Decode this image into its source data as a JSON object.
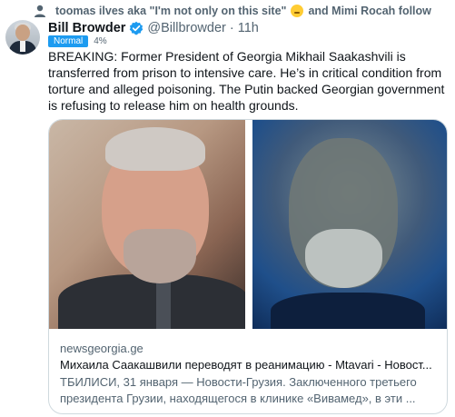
{
  "social_context": {
    "part1": "toomas ilves aka \"I'm not only on this site\"",
    "part2": "and Mimi Rocah follow"
  },
  "tweet": {
    "author_name": "Bill Browder",
    "handle": "@Billbrowder",
    "separator": "·",
    "time": "11h",
    "badge": "Normal",
    "percent": "4%",
    "text": "BREAKING: Former President of Georgia Mikhail Saakashvili is transferred from prison to intensive care. He’s in critical condition from torture and alleged poisoning. The Putin backed Georgian government is refusing to release him on health grounds."
  },
  "card": {
    "domain": "newsgeorgia.ge",
    "title": "Михаила Саакашвили переводят в реанимацию - Mtavari - Новост...",
    "description": "ТБИЛИСИ, 31 января — Новости-Грузия. Заключенного третьего президента Грузии, находящегося в клинике «Вивамед», в эти ..."
  },
  "colors": {
    "verified": "#1d9bf0",
    "badge": "#1d9bf0",
    "secondary_text": "#536471",
    "border": "#cfd9de"
  },
  "icons": {
    "social": "person-icon",
    "verified": "verified-badge-icon",
    "emoji": "emoji-icon"
  }
}
